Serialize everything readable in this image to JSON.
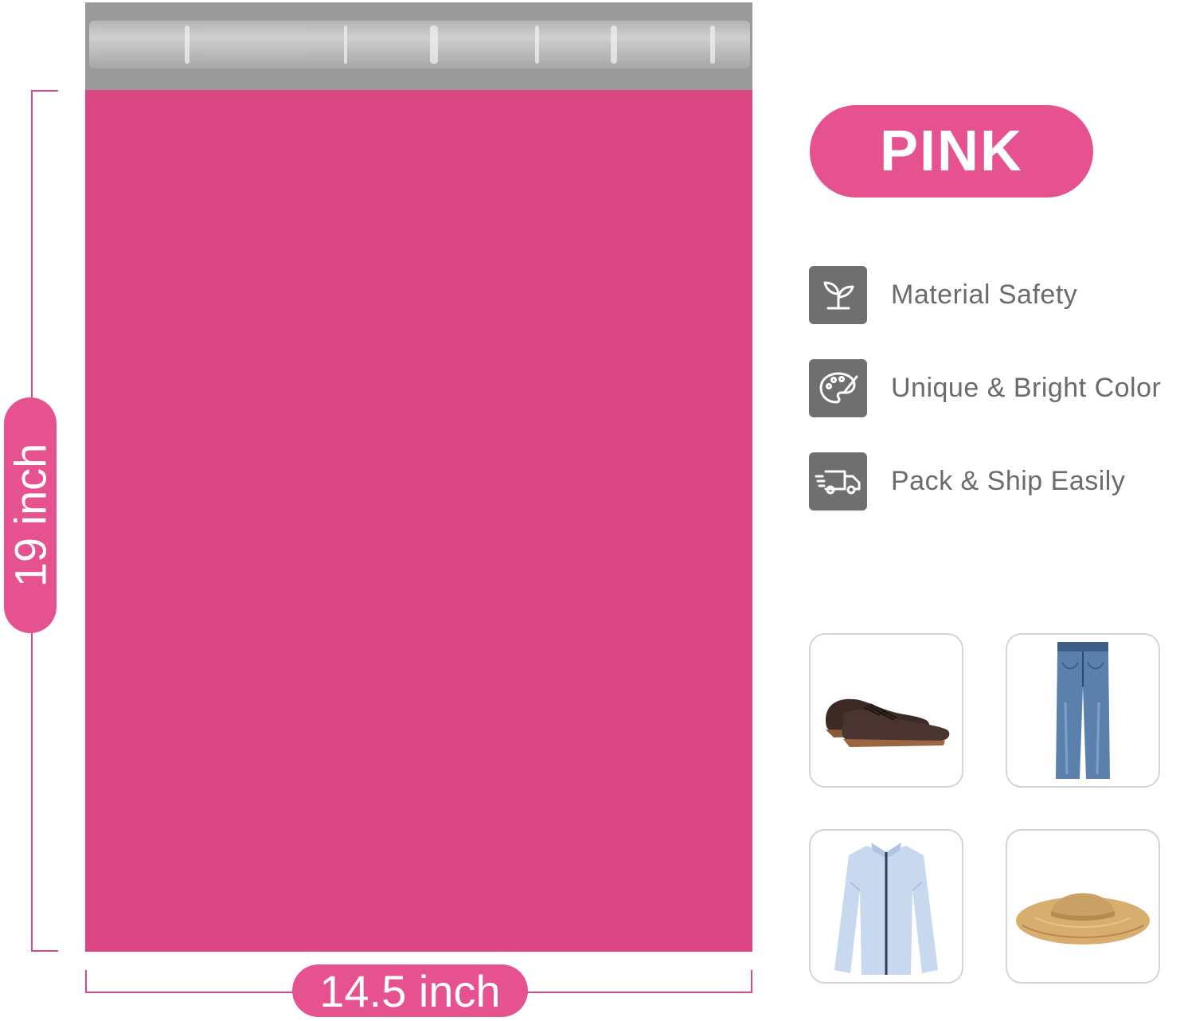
{
  "dimensions": {
    "height_label": "19 inch",
    "width_label": "14.5 inch"
  },
  "color_badge": {
    "label": "PINK"
  },
  "features": [
    {
      "icon": "sprout-icon",
      "label": "Material Safety"
    },
    {
      "icon": "palette-icon",
      "label": "Unique & Bright Color"
    },
    {
      "icon": "delivery-truck-icon",
      "label": "Pack & Ship Easily"
    }
  ],
  "products": [
    {
      "icon": "dress-shoes-icon"
    },
    {
      "icon": "jeans-icon"
    },
    {
      "icon": "dress-shirt-icon"
    },
    {
      "icon": "sun-hat-icon"
    }
  ],
  "colors": {
    "accent_pink": "#e6528f",
    "bag_pink": "#db4783",
    "seal_gray": "#9a9a9a",
    "icon_gray": "#6f6f6f",
    "text_gray": "#6b6b6b"
  }
}
